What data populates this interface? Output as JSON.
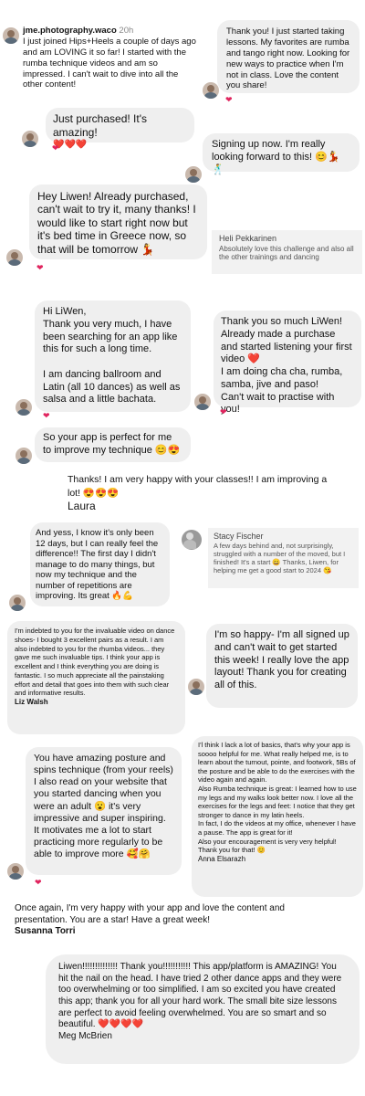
{
  "c1": {
    "username": "jme.photography.waco",
    "time": "20h",
    "text": "I just joined Hips+Heels a couple of days ago and am LOVING it so far!  I started with the rumba technique videos and am so impressed.  I can't wait to dive into all the other content!"
  },
  "c2": {
    "text": "Thank you! I just started taking lessons. My favorites are rumba and tango right now. Looking for new ways to practice when I'm not in class. Love the content you share!"
  },
  "c3": {
    "text": "Just purchased! It's amazing!",
    "hearts": "❤️❤️❤️"
  },
  "c4": {
    "text": "Signing up now. I'm really looking forward to this! 😊💃🕺"
  },
  "c5": {
    "text": "Hey Liwen! Already purchased, can't wait to try it, many thanks! I would like to start right now but it's bed time in Greece now, so that will be tomorrow 💃"
  },
  "c6": {
    "author": "Heli Pekkarinen",
    "text": "Absolutely love this challenge and also all the other trainings and dancing"
  },
  "c7": {
    "text": "Hi LiWen,\nThank you very much, I have been searching for an app like this for such a long time.\n\nI am dancing ballroom and Latin (all 10 dances) as well as salsa and a little bachata."
  },
  "c8": {
    "text": "Thank you so much LiWen! Already made a purchase and started listening your first video ❤️\nI am doing cha cha, rumba, samba, jive and paso!\nCan't wait to practise with you!"
  },
  "c9": {
    "text": "So your app is perfect for me to improve my technique 😊😍"
  },
  "c10": {
    "text": "Thanks!  I am very happy with your classes!! I am improving a lot! 😍😍😍",
    "author": "Laura"
  },
  "c11": {
    "text": "And yess, I know it's only been 12 days, but I can really feel the difference!! The first day I didn't manage to do many things, but now my technique and the number of repetitions are improving. Its great 🔥💪"
  },
  "c12": {
    "author": "Stacy Fischer",
    "text": "A few days behind and, not surprisingly, struggled with a number of the moved, but I finished! It's a start 😀 Thanks, Liwen, for helping me get a good start to 2024 😘"
  },
  "c13": {
    "text": "I'm indebted to you for the invaluable video on dance shoes- I bought 3 excellent pairs as a result. I am also indebted to you for the rhumba videos... they gave me such invaluable tips. I think your app is excellent and I think everything you are doing is fantastic. I so much appreciate all the painstaking effort and detail that goes into them with such clear and informative results.",
    "author": "Liz Walsh"
  },
  "c14": {
    "text": "I'm so happy- I'm all signed up and can't wait to get started this week!  I really love the app layout!  Thank you for creating all of this."
  },
  "c15": {
    "text": "I'l think I lack a lot of basics, that's why your app is soooo helpful for me. What really helped me, is to learn about the turnout, pointe, and footwork, 5Bs of the posture and be able to do the exercises with the video again and again.\nAlso Rumba technique is great: I learned how to use my legs and my walks look better now. I love all the exercises for the legs and feet: I notice that they get stronger to dance in my latin heels.\nIn fact, I do the videos at my office, whenever I have a pause. The app is great for it!\nAlso your encouragement is very very helpful! Thank you for that! 😊",
    "author": "Anna Elsarazh"
  },
  "c16": {
    "text": "You have amazing posture and spins technique (from your reels)\nI also read on your website that you started dancing when you were an adult 😮 it's very impressive and super inspiring. It motivates me a lot to start practicing more regularly to be able to improve more 🥰🤗"
  },
  "c17": {
    "text": "Once again, I'm very happy with your app and love the content and presentation. You are a star! Have a great week!",
    "author": "Susanna Torri"
  },
  "c18": {
    "text": "Liwen!!!!!!!!!!!!!! Thank you!!!!!!!!!!! This app/platform is AMAZING! You hit the nail on the head. I have tried 2 other dance apps and they were too overwhelming or too simplified. I am so excited you have created this app; thank you for all your hard work. The small bite size lessons are perfect to avoid feeling overwhelmed. You are so smart and so beautiful. ❤️❤️❤️❤️",
    "author": "Meg McBrien"
  },
  "heart": "❤"
}
